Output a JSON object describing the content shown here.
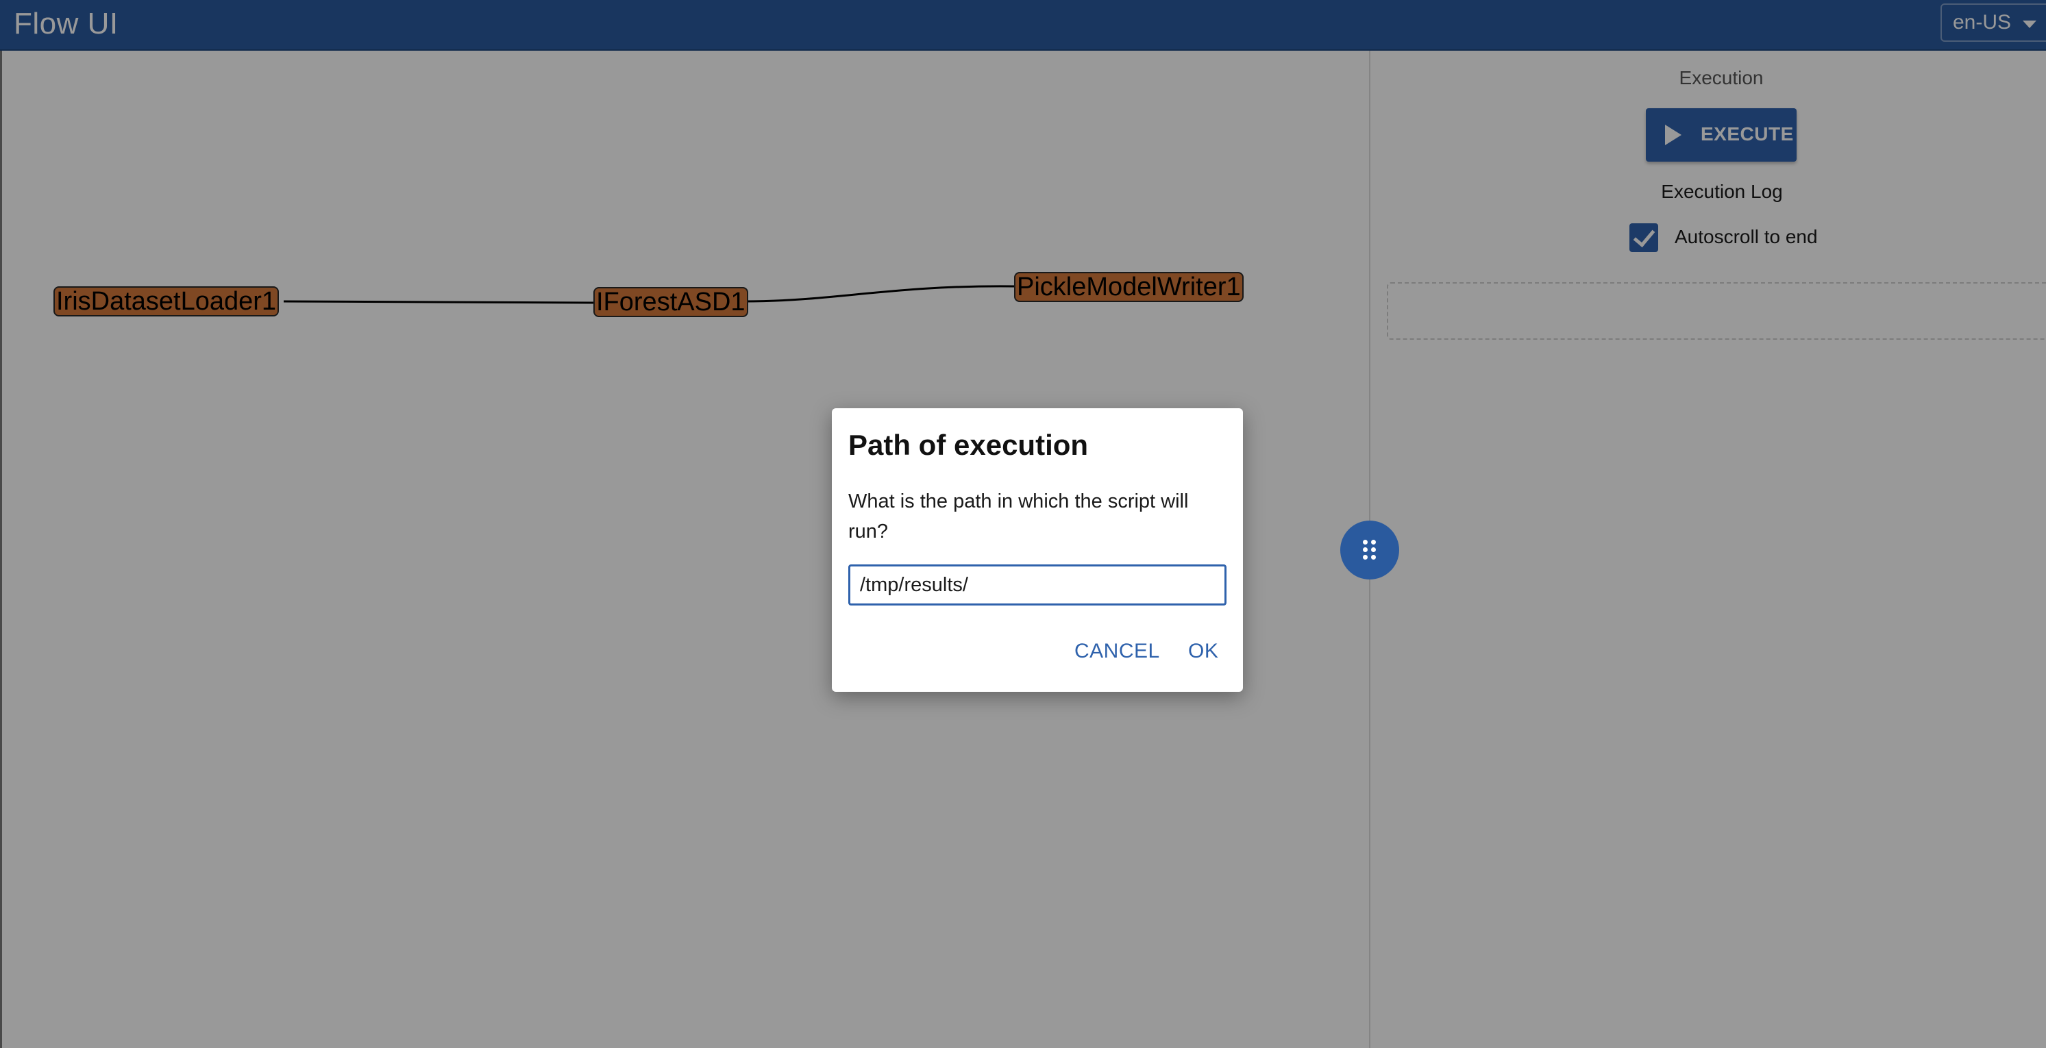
{
  "app": {
    "title": "Flow UI",
    "language": "en-US"
  },
  "nodes": [
    {
      "label": "IrisDatasetLoader1"
    },
    {
      "label": "IForestASD1"
    },
    {
      "label": "PickleModelWriter1"
    }
  ],
  "panel": {
    "title": "Execution",
    "execute_label": "EXECUTE",
    "log_title": "Execution Log",
    "autoscroll_label": "Autoscroll to end",
    "autoscroll_checked": true
  },
  "dialog": {
    "title": "Path of execution",
    "question": "What is the path in which the script will run?",
    "path_value": "/tmp/results/",
    "cancel_label": "CANCEL",
    "ok_label": "OK"
  },
  "colors": {
    "header": "#2a5a9e",
    "accent": "#2f62ac",
    "node_fill": "#d4793b",
    "overlay": "rgba(0,0,0,0.40)"
  },
  "icons": {
    "play": "play-icon",
    "checkbox": "checkmark-icon",
    "drag_handle": "drag-handle-icon",
    "dropdown": "chevron-down-icon"
  }
}
